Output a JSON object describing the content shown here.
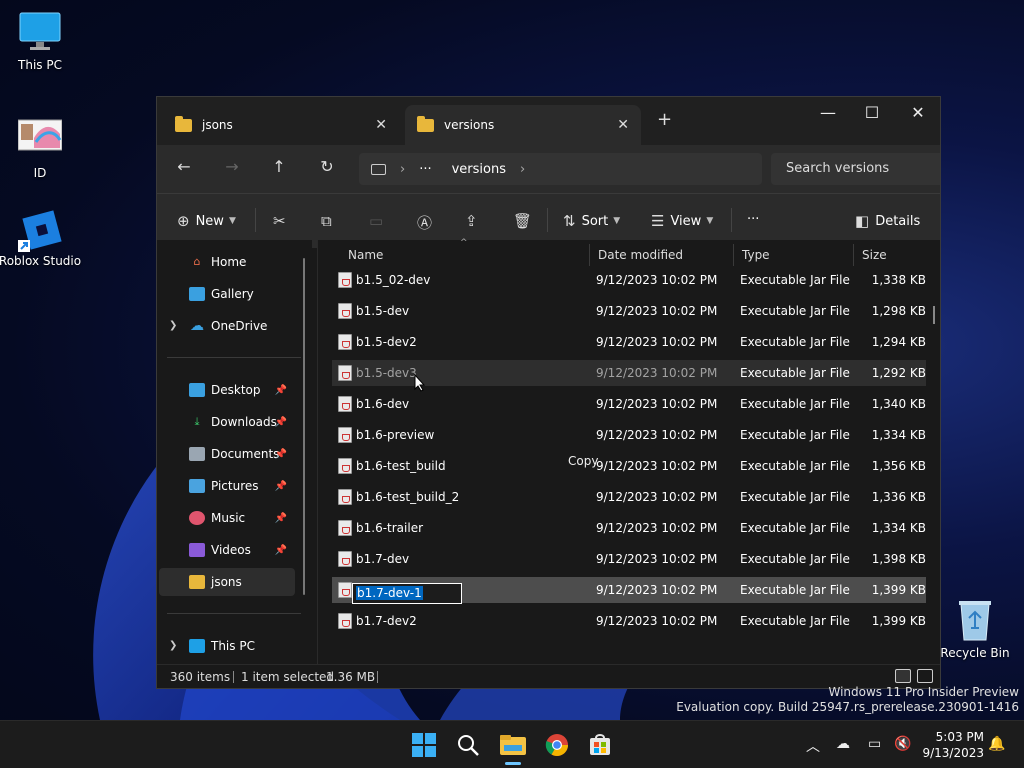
{
  "desktop": {
    "icons": [
      {
        "label": "This PC"
      },
      {
        "label": "ID"
      },
      {
        "label": "Roblox Studio"
      },
      {
        "label": "Recycle Bin"
      }
    ],
    "watermark": {
      "line1": "Windows 11 Pro Insider Preview",
      "line2": "Evaluation copy. Build 25947.rs_prerelease.230901-1416"
    }
  },
  "window": {
    "tabs": [
      {
        "label": "jsons",
        "active": false
      },
      {
        "label": "versions",
        "active": true
      }
    ],
    "controls": {
      "minimize": "—",
      "maximize": "☐",
      "close": "✕",
      "new_tab": "+"
    },
    "address": {
      "more": "···",
      "current": "versions",
      "search_placeholder": "Search versions"
    },
    "toolbar": {
      "new_label": "New",
      "sort_label": "Sort",
      "view_label": "View",
      "more_label": "···",
      "details_label": "Details"
    },
    "sidebar": {
      "items": [
        {
          "label": "Home",
          "pinned": false
        },
        {
          "label": "Gallery",
          "pinned": false
        },
        {
          "label": "OneDrive",
          "pinned": false
        },
        {
          "label": "Desktop",
          "pinned": true
        },
        {
          "label": "Downloads",
          "pinned": true
        },
        {
          "label": "Documents",
          "pinned": true
        },
        {
          "label": "Pictures",
          "pinned": true
        },
        {
          "label": "Music",
          "pinned": true
        },
        {
          "label": "Videos",
          "pinned": true
        },
        {
          "label": "jsons",
          "pinned": false,
          "selected": true
        },
        {
          "label": "This PC",
          "pinned": false
        }
      ]
    },
    "columns": {
      "name": "Name",
      "date": "Date modified",
      "type": "Type",
      "size": "Size"
    },
    "files": [
      {
        "name": "b1.5_02-dev",
        "date": "9/12/2023 10:02 PM",
        "type": "Executable Jar File",
        "size": "1,338 KB"
      },
      {
        "name": "b1.5-dev",
        "date": "9/12/2023 10:02 PM",
        "type": "Executable Jar File",
        "size": "1,298 KB"
      },
      {
        "name": "b1.5-dev2",
        "date": "9/12/2023 10:02 PM",
        "type": "Executable Jar File",
        "size": "1,294 KB"
      },
      {
        "name": "b1.5-dev3",
        "date": "9/12/2023 10:02 PM",
        "type": "Executable Jar File",
        "size": "1,292 KB",
        "state": "hover"
      },
      {
        "name": "b1.6-dev",
        "date": "9/12/2023 10:02 PM",
        "type": "Executable Jar File",
        "size": "1,340 KB"
      },
      {
        "name": "b1.6-preview",
        "date": "9/12/2023 10:02 PM",
        "type": "Executable Jar File",
        "size": "1,334 KB"
      },
      {
        "name": "b1.6-test_build",
        "date": "9/12/2023 10:02 PM",
        "type": "Executable Jar File",
        "size": "1,356 KB"
      },
      {
        "name": "b1.6-test_build_2",
        "date": "9/12/2023 10:02 PM",
        "type": "Executable Jar File",
        "size": "1,336 KB"
      },
      {
        "name": "b1.6-trailer",
        "date": "9/12/2023 10:02 PM",
        "type": "Executable Jar File",
        "size": "1,334 KB"
      },
      {
        "name": "b1.7-dev",
        "date": "9/12/2023 10:02 PM",
        "type": "Executable Jar File",
        "size": "1,398 KB"
      },
      {
        "name": "b1.7-dev-1",
        "date": "9/12/2023 10:02 PM",
        "type": "Executable Jar File",
        "size": "1,399 KB",
        "state": "selected-rename"
      },
      {
        "name": "b1.7-dev2",
        "date": "9/12/2023 10:02 PM",
        "type": "Executable Jar File",
        "size": "1,399 KB"
      }
    ],
    "drag_tooltip": "Copy",
    "status": {
      "items": "360 items",
      "selection": "1 item selected",
      "size": "1.36 MB"
    }
  },
  "taskbar": {
    "clock_time": "5:03 PM",
    "clock_date": "9/13/2023"
  },
  "colors": {
    "folder": "#e8b73b",
    "accent": "#0067c0",
    "window_bg": "#191919",
    "chrome_bg": "#2b2b2b"
  }
}
